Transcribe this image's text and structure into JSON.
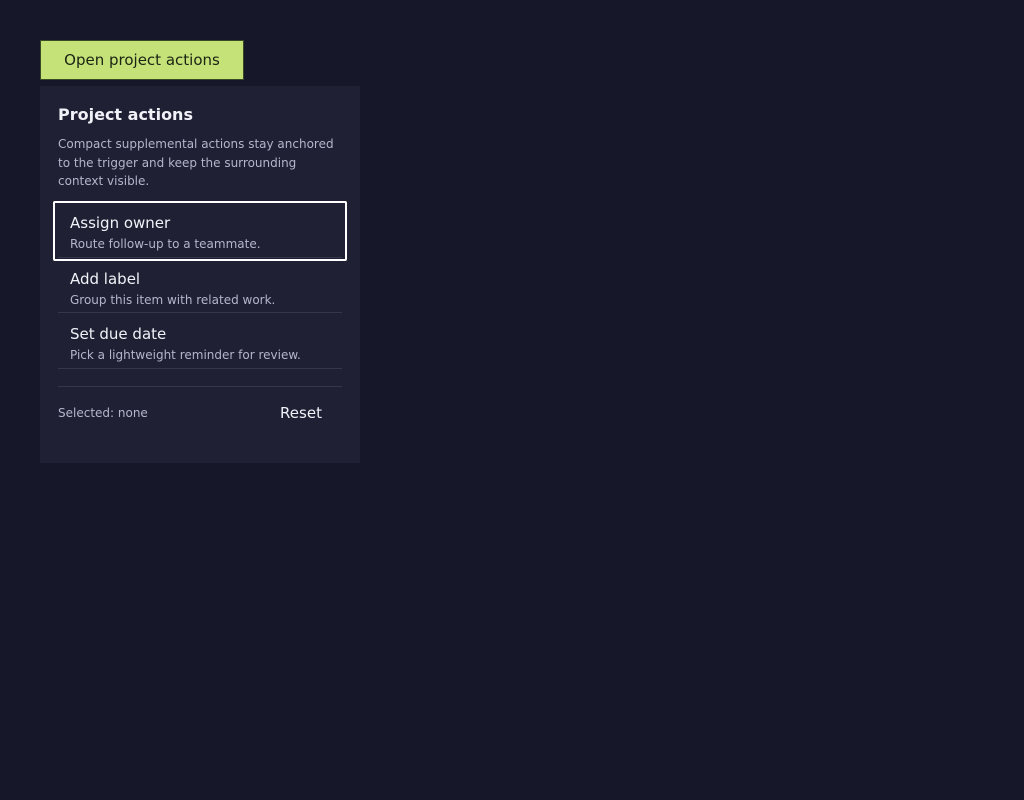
{
  "trigger": {
    "label": "Open project actions"
  },
  "panel": {
    "title": "Project actions",
    "description": "Compact supplemental actions stay anchored to the trigger and keep the surrounding context visible.",
    "items": [
      {
        "title": "Assign owner",
        "description": "Route follow-up to a teammate."
      },
      {
        "title": "Add label",
        "description": "Group this item with related work."
      },
      {
        "title": "Set due date",
        "description": "Pick a lightweight reminder for review."
      }
    ],
    "selected_text": "Selected: none",
    "reset_label": "Reset"
  },
  "colors": {
    "background": "#16182a",
    "panel": "#1f2033",
    "accent": "#c5e279",
    "focus_ring": "#ffffff"
  }
}
